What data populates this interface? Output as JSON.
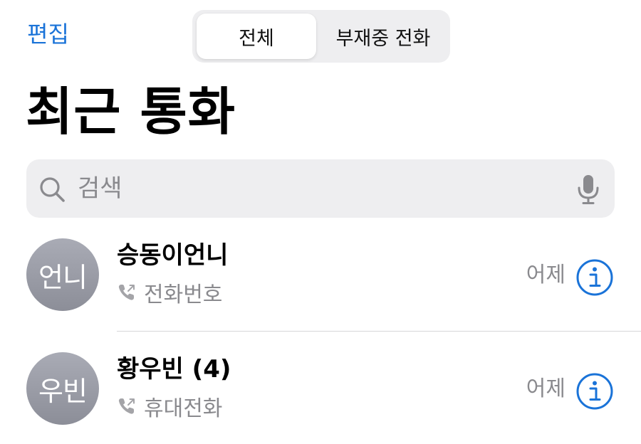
{
  "header": {
    "edit_label": "편집",
    "segments": [
      {
        "label": "전체",
        "selected": true
      },
      {
        "label": "부재중 전화",
        "selected": false
      }
    ],
    "title": "최근 통화"
  },
  "search": {
    "placeholder": "검색",
    "value": ""
  },
  "calls": [
    {
      "avatar_initials": "언니",
      "name": "승동이언니",
      "call_type": "전화번호",
      "time": "어제"
    },
    {
      "avatar_initials": "우빈",
      "name": "황우빈 (4)",
      "call_type": "휴대전화",
      "time": "어제"
    }
  ],
  "colors": {
    "accent": "#1a73d8",
    "secondary_text": "#8a8a8e",
    "search_bg": "#eeeef0",
    "avatar_gray": "#9a9ca6"
  },
  "icons": {
    "search": "search-icon",
    "mic": "microphone-icon",
    "phone_outgoing": "outgoing-call-icon",
    "info": "info-icon"
  }
}
